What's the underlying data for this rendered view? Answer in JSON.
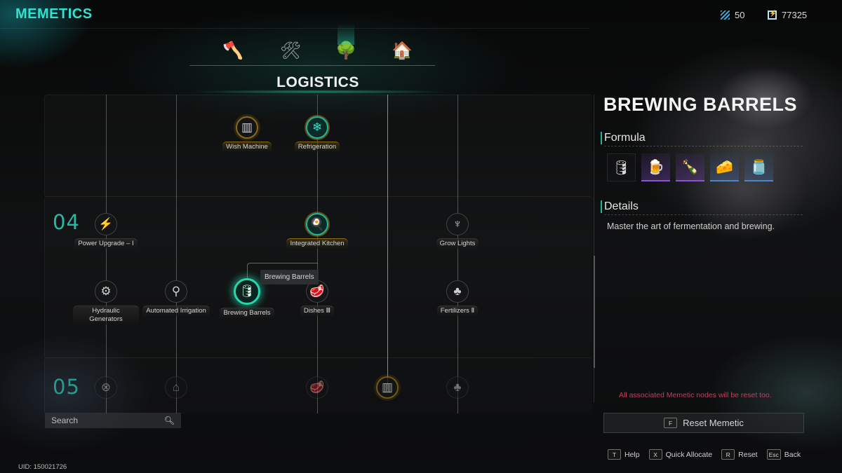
{
  "app": {
    "title": "MEMETICS"
  },
  "currencies": [
    {
      "icon": "memetic-shard-icon",
      "value": "50"
    },
    {
      "icon": "fuse-points-icon",
      "value": "77325"
    }
  ],
  "category_tabs": [
    {
      "name": "combat",
      "icon": "🪓",
      "active": false
    },
    {
      "name": "crafting",
      "icon": "🛠",
      "active": false
    },
    {
      "name": "logistics",
      "icon": "🌳",
      "active": true
    },
    {
      "name": "territory",
      "icon": "🏠",
      "active": false
    }
  ],
  "section_title": "LOGISTICS",
  "tiers": [
    {
      "label": "04"
    },
    {
      "label": "05"
    }
  ],
  "nodes": {
    "wish_machine": {
      "label": "Wish Machine",
      "icon": "▥"
    },
    "refrigeration": {
      "label": "Refrigeration",
      "icon": "❄"
    },
    "power_upgrade": {
      "label": "Power Upgrade – I",
      "icon": "⚡"
    },
    "integrated_kitchen": {
      "label": "Integrated Kitchen",
      "icon": "🍳"
    },
    "grow_lights": {
      "label": "Grow Lights",
      "icon": "♆"
    },
    "hydraulic_generators": {
      "label": "Hydraulic Generators",
      "icon": "⚙"
    },
    "automated_irrigation": {
      "label": "Automated Irrigation",
      "icon": "⚲"
    },
    "brewing_barrels": {
      "label": "Brewing Barrels",
      "icon": "🛢"
    },
    "dishes_3": {
      "label": "Dishes Ⅲ",
      "icon": "🥩"
    },
    "fertilizers_2": {
      "label": "Fertilizers Ⅱ",
      "icon": "♣"
    },
    "t05_a": {
      "icon": "⊗"
    },
    "t05_b": {
      "icon": "⌂"
    },
    "t05_c": {
      "icon": "🥩"
    },
    "t05_d": {
      "icon": "▥"
    },
    "t05_e": {
      "icon": "♣"
    }
  },
  "tooltip": "Brewing Barrels",
  "search": {
    "placeholder": "Search",
    "value": ""
  },
  "uid": "UID: 150021726",
  "detail_panel": {
    "title": "BREWING BARRELS",
    "formula_heading": "Formula",
    "formula": [
      {
        "name": "barrel",
        "icon": "🛢",
        "rarity": "common"
      },
      {
        "name": "beer",
        "icon": "🍺",
        "rarity": "epic"
      },
      {
        "name": "bottle",
        "icon": "🍾",
        "rarity": "epic"
      },
      {
        "name": "cheese",
        "icon": "🧀",
        "rarity": "rare"
      },
      {
        "name": "pickles-jar",
        "icon": "🫙",
        "rarity": "rare"
      }
    ],
    "details_heading": "Details",
    "details_text": "Master the art of fermentation and brewing.",
    "warning": "All associated Memetic nodes will be reset too.",
    "reset_button": {
      "key": "F",
      "label": "Reset Memetic"
    }
  },
  "hints": [
    {
      "key": "T",
      "label": "Help"
    },
    {
      "key": "X",
      "label": "Quick Allocate"
    },
    {
      "key": "R",
      "label": "Reset"
    },
    {
      "key": "Esc",
      "label": "Back"
    }
  ]
}
